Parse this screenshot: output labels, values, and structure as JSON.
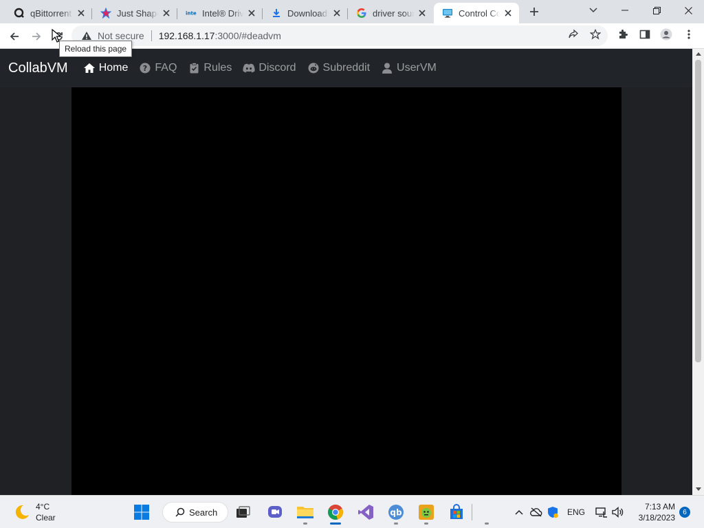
{
  "browser": {
    "tabs": [
      {
        "title": "qBittorrent",
        "icon": "qbittorrent-icon"
      },
      {
        "title": "Just Shapes",
        "icon": "just-shapes-icon"
      },
      {
        "title": "Intel® Driv",
        "icon": "intel-icon"
      },
      {
        "title": "Downloads",
        "icon": "download-icon"
      },
      {
        "title": "driver sour",
        "icon": "google-icon"
      },
      {
        "title": "Control Co",
        "icon": "monitor-icon"
      }
    ],
    "tooltip": "Reload this page",
    "address": {
      "security_label": "Not secure",
      "host": "192.168.1.17",
      "path": ":3000/#deadvm"
    }
  },
  "site": {
    "brand": "CollabVM",
    "nav": [
      {
        "label": "Home",
        "icon": "home-icon",
        "active": true
      },
      {
        "label": "FAQ",
        "icon": "question-circle-icon",
        "active": false
      },
      {
        "label": "Rules",
        "icon": "clipboard-check-icon",
        "active": false
      },
      {
        "label": "Discord",
        "icon": "discord-icon",
        "active": false
      },
      {
        "label": "Subreddit",
        "icon": "reddit-icon",
        "active": false
      },
      {
        "label": "UserVM",
        "icon": "user-icon",
        "active": false
      }
    ]
  },
  "taskbar": {
    "weather": {
      "temp": "4°C",
      "condition": "Clear"
    },
    "search_label": "Search",
    "language": "ENG",
    "time": "7:13 AM",
    "date": "3/18/2023",
    "notification_count": "6"
  },
  "colors": {
    "navbar_bg": "#212529",
    "vm_screen": "#000000",
    "accent": "#0067c0"
  }
}
